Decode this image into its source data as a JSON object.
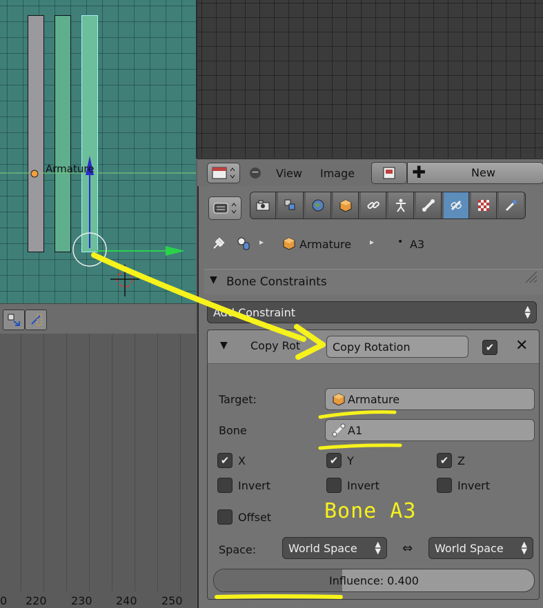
{
  "viewport": {
    "object_label": "Armature"
  },
  "viewport_header": {
    "icons": [
      "snap-icon",
      "proportional-edit-icon"
    ]
  },
  "timeline": {
    "ticks": [
      "0",
      "220",
      "230",
      "240",
      "250"
    ]
  },
  "image_editor": {
    "header": {
      "menu_view": "View",
      "menu_image": "Image",
      "new_label": "New"
    }
  },
  "properties": {
    "tabs": [
      "render-icon",
      "render-layers-icon",
      "world-icon",
      "object-icon",
      "constraints-icon",
      "object-data-icon",
      "bone-icon",
      "bone-constraint-icon",
      "texture-icon",
      "particles-icon"
    ],
    "breadcrumb": {
      "object": "Armature",
      "bone": "A3"
    },
    "panel_title": "Bone Constraints",
    "add_constraint_label": "Add Constraint",
    "constraint": {
      "type_label": "Copy Rot",
      "name_value": "Copy Rotation",
      "enabled": true,
      "target_label": "Target:",
      "target_value": "Armature",
      "bone_label": "Bone",
      "bone_value": "A1",
      "axes": [
        {
          "label": "X",
          "checked": true
        },
        {
          "label": "Y",
          "checked": true
        },
        {
          "label": "Z",
          "checked": true
        }
      ],
      "invert_label": "Invert",
      "offset_label": "Offset",
      "space_label": "Space:",
      "owner_space": "World Space",
      "target_space": "World Space",
      "influence_text": "Influence: 0.400",
      "influence": 0.4
    }
  },
  "annotation": {
    "text": "Bone A3",
    "color": "#f6f21c"
  },
  "colors": {
    "selected_tab": "#5c8dbb",
    "viewport_bg": "#3f7f78",
    "annotation": "#f6f21c"
  }
}
